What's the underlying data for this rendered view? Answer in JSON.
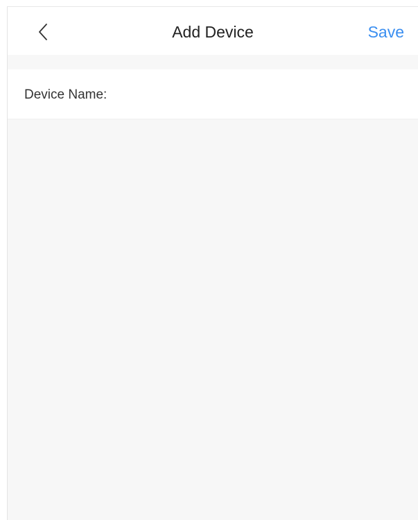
{
  "nav": {
    "title": "Add Device",
    "save_label": "Save",
    "back_icon": "chevron-left-icon"
  },
  "form": {
    "device_name_label": "Device Name:",
    "device_name_value": "",
    "device_name_placeholder": ""
  },
  "colors": {
    "accent": "#3a8ef0",
    "background": "#f7f7f7",
    "surface": "#ffffff",
    "text": "#222222"
  }
}
